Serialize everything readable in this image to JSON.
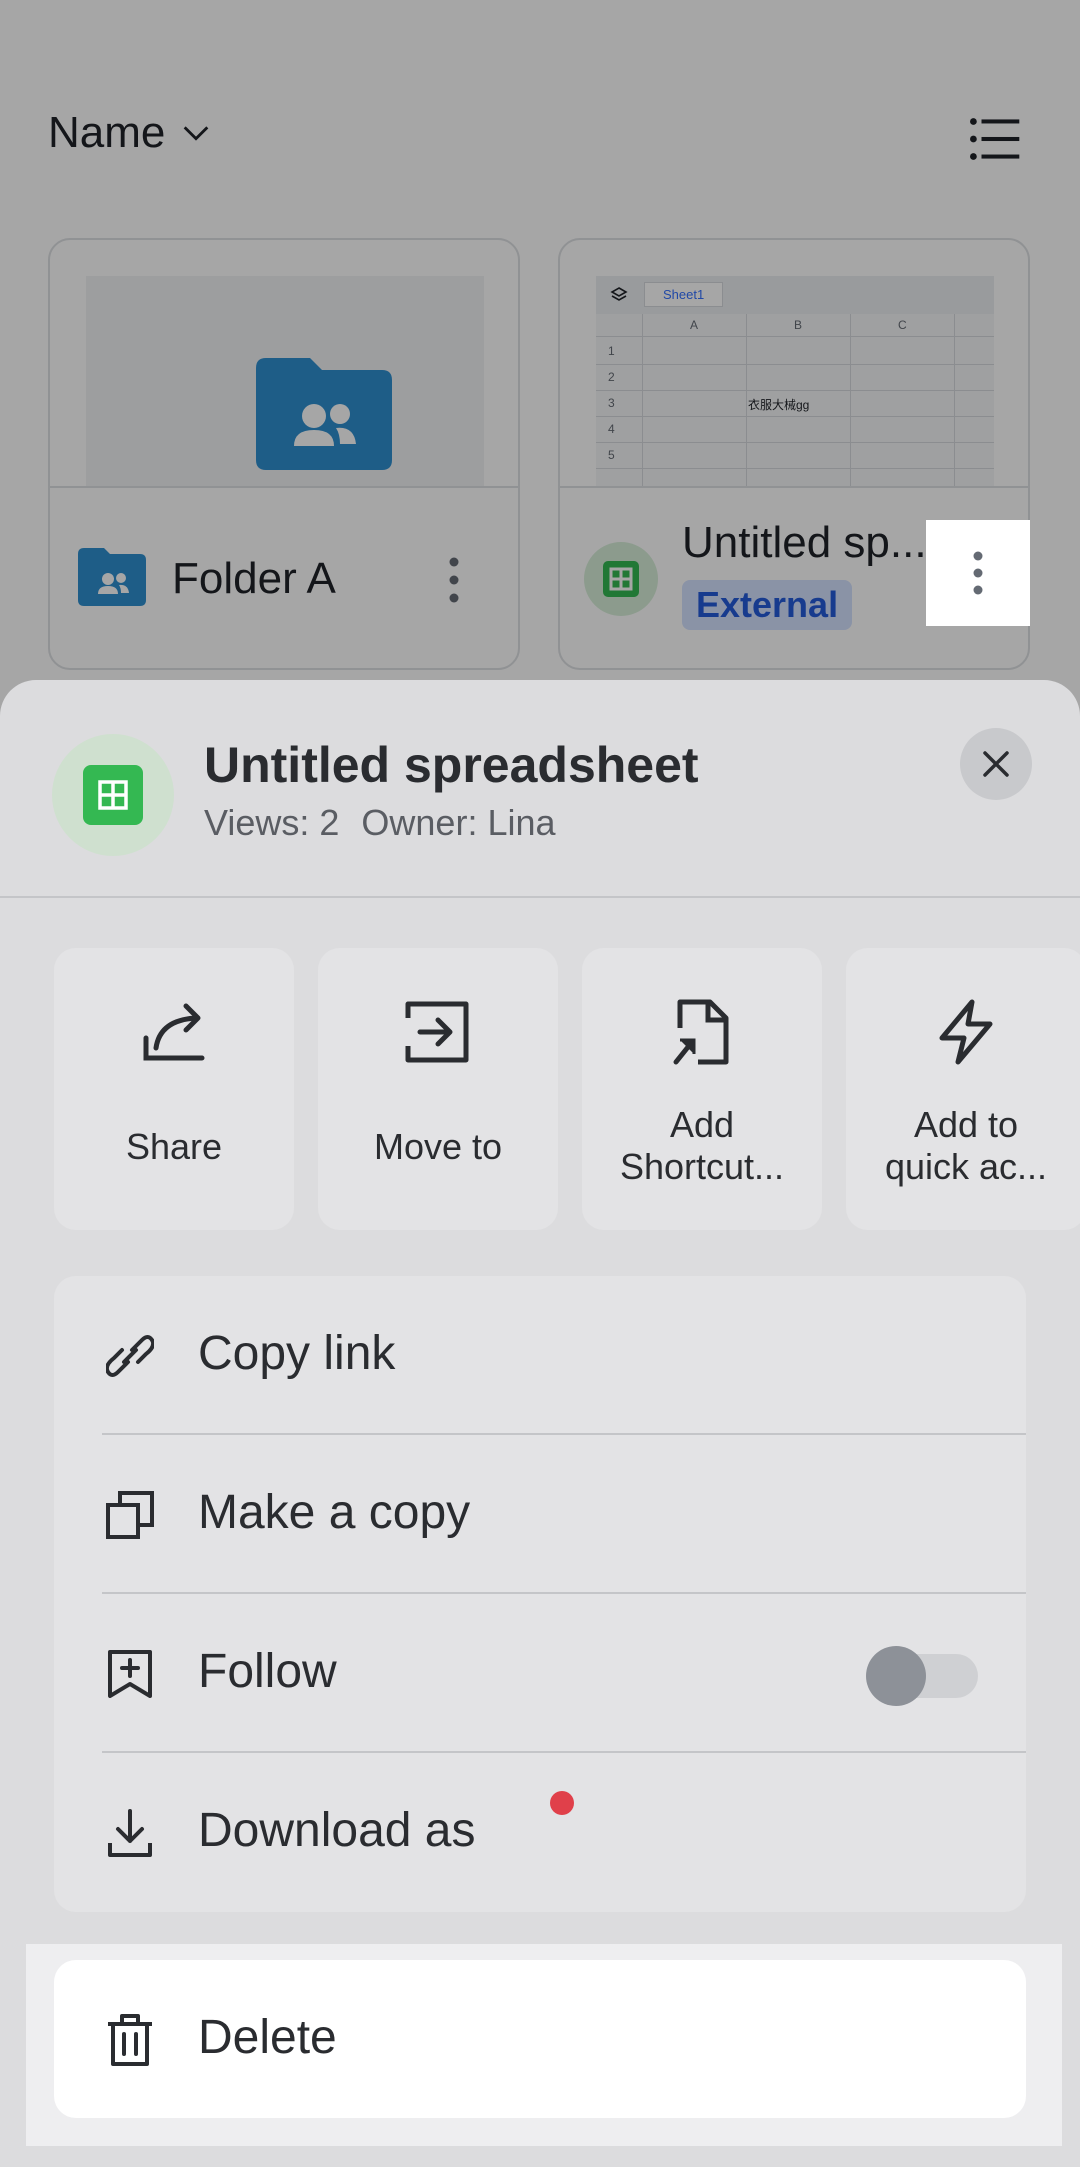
{
  "header": {
    "sort_label": "Name"
  },
  "files": [
    {
      "name": "Folder A"
    },
    {
      "name": "Untitled sp...",
      "badge": "External",
      "thumbnail": {
        "tab": "Sheet1",
        "columns": [
          "A",
          "B",
          "C"
        ],
        "rows": [
          "1",
          "2",
          "3",
          "4",
          "5"
        ],
        "cell_text": "衣服大械gg"
      }
    }
  ],
  "sheet": {
    "title": "Untitled spreadsheet",
    "views": "Views: 2",
    "owner": "Owner: Lina",
    "actions": [
      {
        "label": "Share",
        "icon": "share-icon"
      },
      {
        "label": "Move to",
        "icon": "move-to-icon"
      },
      {
        "label": "Add Shortcut...",
        "icon": "add-shortcut-icon"
      },
      {
        "label": "Add to quick ac...",
        "icon": "lightning-icon"
      }
    ],
    "menu": [
      {
        "label": "Copy link",
        "icon": "link-icon"
      },
      {
        "label": "Make a copy",
        "icon": "copy-icon"
      },
      {
        "label": "Follow",
        "icon": "bookmark-plus-icon",
        "toggle_on": false
      },
      {
        "label": "Download as",
        "icon": "download-icon",
        "new_dot": true
      }
    ],
    "delete_label": "Delete"
  },
  "colors": {
    "accent_green": "#34b852",
    "badge_blue": "#245bdb",
    "alert_red": "#e0404a",
    "folder_blue": "#1f6fa8"
  }
}
